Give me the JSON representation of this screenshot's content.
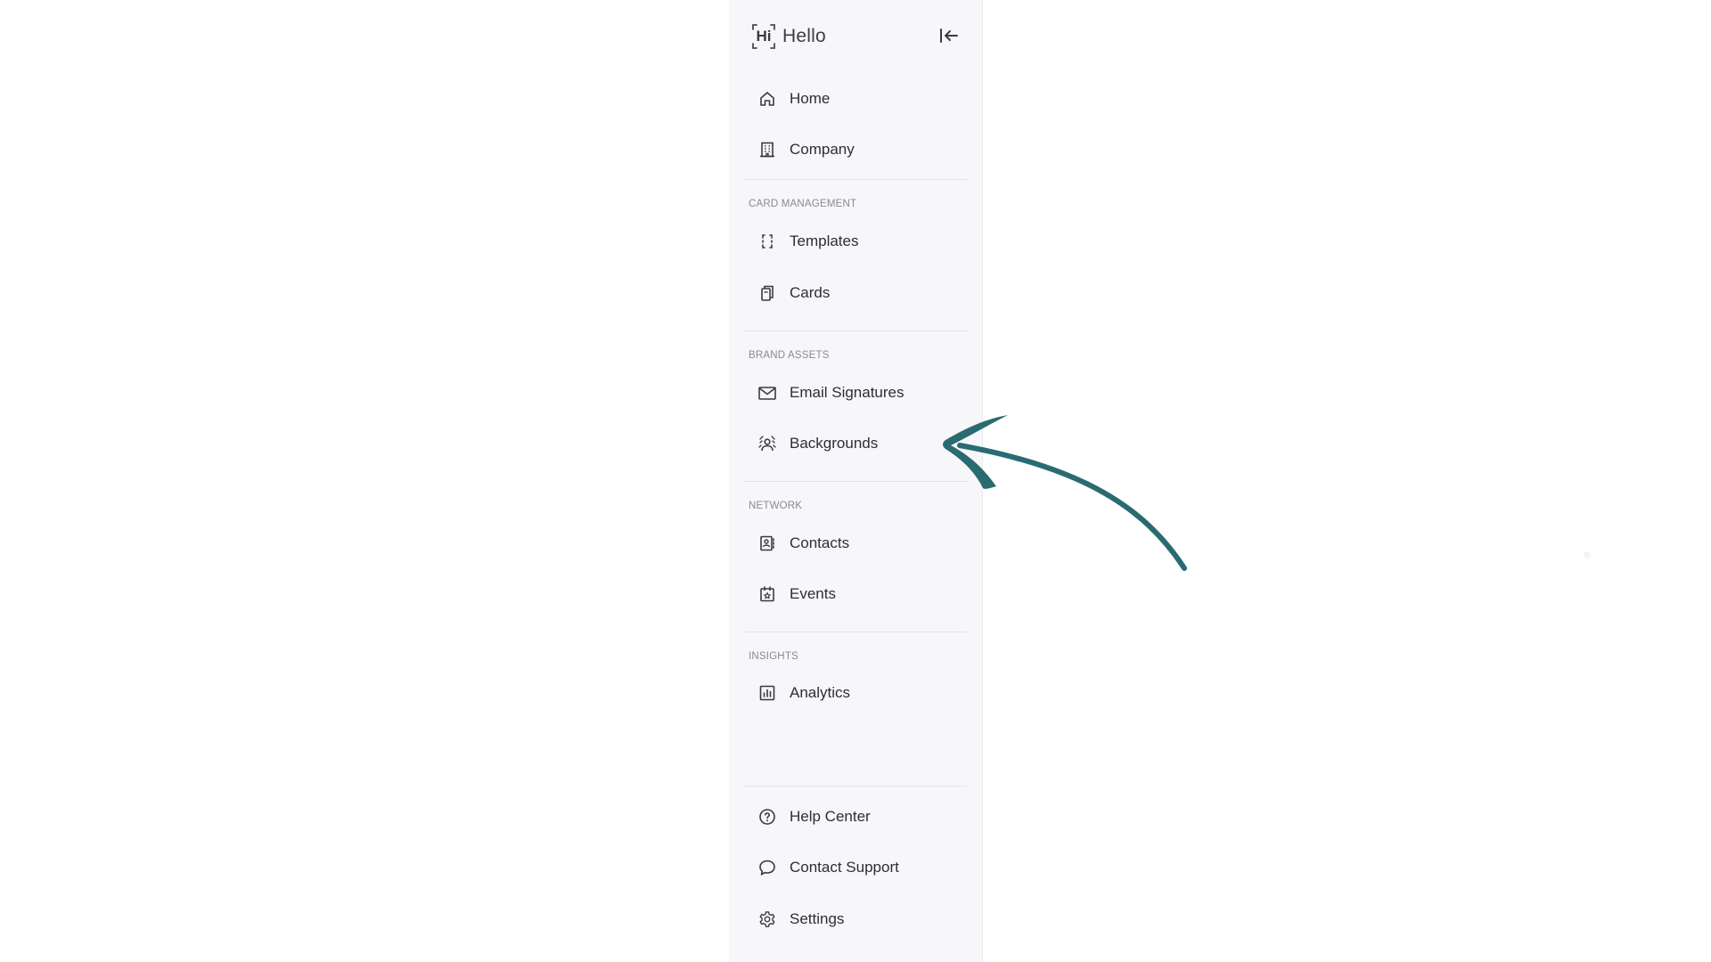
{
  "brand": {
    "logo_text": "Hi",
    "name": "Hello"
  },
  "nav": {
    "top_items": [
      {
        "label": "Home",
        "icon": "home-icon"
      },
      {
        "label": "Company",
        "icon": "building-icon"
      }
    ],
    "sections": [
      {
        "title": "CARD MANAGEMENT",
        "items": [
          {
            "label": "Templates",
            "icon": "template-frame-icon"
          },
          {
            "label": "Cards",
            "icon": "cards-stack-icon"
          }
        ]
      },
      {
        "title": "BRAND ASSETS",
        "items": [
          {
            "label": "Email Signatures",
            "icon": "mail-icon"
          },
          {
            "label": "Backgrounds",
            "icon": "background-person-icon"
          }
        ]
      },
      {
        "title": "NETWORK",
        "items": [
          {
            "label": "Contacts",
            "icon": "contact-book-icon"
          },
          {
            "label": "Events",
            "icon": "calendar-star-icon"
          }
        ]
      },
      {
        "title": "INSIGHTS",
        "items": [
          {
            "label": "Analytics",
            "icon": "bar-chart-icon"
          }
        ]
      }
    ],
    "bottom_items": [
      {
        "label": "Help Center",
        "icon": "help-circle-icon"
      },
      {
        "label": "Contact Support",
        "icon": "chat-bubble-icon"
      },
      {
        "label": "Settings",
        "icon": "gear-icon"
      }
    ]
  },
  "colors": {
    "sidebar_bg": "#f7f6f8",
    "text": "#2e2e33",
    "section_title": "#8b8a91",
    "annotation_arrow": "#2a6b72"
  }
}
